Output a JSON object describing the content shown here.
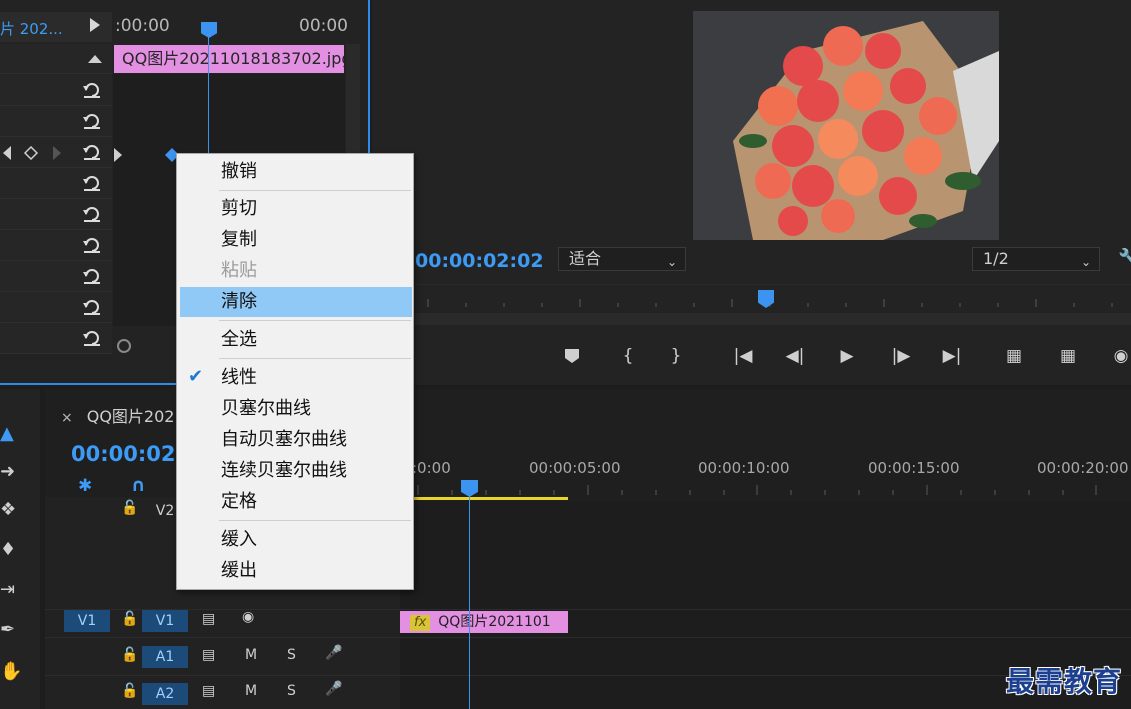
{
  "effect_controls": {
    "sequence_label": "片 202...",
    "ruler_start": ":00:00",
    "ruler_end": "00:00",
    "clip_name": "QQ图片20211018183702.jpg"
  },
  "program_monitor": {
    "timecode": "00:00:02:02",
    "fit_select": "适合",
    "resolution_select": "1/2"
  },
  "timeline": {
    "sequence_tab": "QQ图片202",
    "close_glyph": "×",
    "timecode": "00:00:02:0",
    "ruler_labels": [
      ":0:00",
      "00:00:05:00",
      "00:00:10:00",
      "00:00:15:00",
      "00:00:20:00"
    ],
    "tracks": {
      "v2": "V2",
      "v1_source": "V1",
      "v1": "V1",
      "a1": "A1",
      "a2": "A2",
      "m": "M",
      "s": "S"
    },
    "clip_label": "QQ图片2021101",
    "fx": "fx"
  },
  "context_menu": {
    "items": [
      {
        "label": "撤销"
      },
      {
        "label": "剪切"
      },
      {
        "label": "复制"
      },
      {
        "label": "粘贴",
        "disabled": true
      },
      {
        "label": "清除",
        "highlighted": true
      },
      {
        "label": "全选"
      },
      {
        "label": "线性",
        "checked": true
      },
      {
        "label": "贝塞尔曲线"
      },
      {
        "label": "自动贝塞尔曲线"
      },
      {
        "label": "连续贝塞尔曲线"
      },
      {
        "label": "定格"
      },
      {
        "label": "缓入"
      },
      {
        "label": "缓出"
      }
    ]
  },
  "watermark": "最需教育",
  "colors": {
    "accent_blue": "#3d9bf5",
    "clip_pink": "#e390e2",
    "menu_highlight": "#90c8f6",
    "in_out_bar": "#e8d42a"
  }
}
